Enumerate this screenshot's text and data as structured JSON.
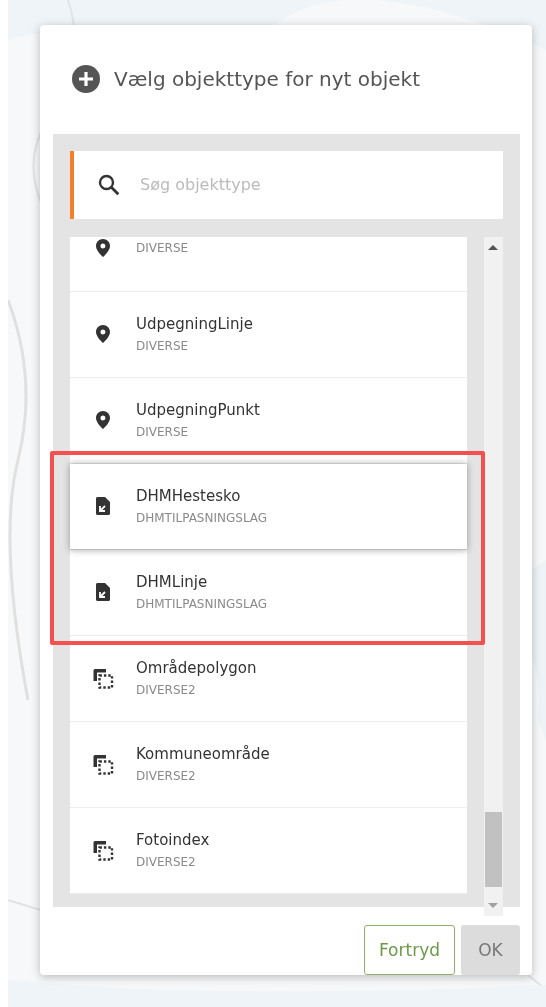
{
  "dialog": {
    "title": "Vælg objekttype for nyt objekt",
    "search": {
      "placeholder": "Søg objekttype"
    },
    "items": [
      {
        "category": "DIVERSE",
        "kind": "pin",
        "hovered": false,
        "highlighted": false
      },
      {
        "name": "UdpegningLinje",
        "category": "DIVERSE",
        "kind": "pin",
        "hovered": false,
        "highlighted": false
      },
      {
        "name": "UdpegningPunkt",
        "category": "DIVERSE",
        "kind": "pin",
        "hovered": false,
        "highlighted": false
      },
      {
        "name": "DHMHestesko",
        "category": "DHMTILPASNINGSLAG",
        "kind": "file",
        "hovered": true,
        "highlighted": true
      },
      {
        "name": "DHMLinje",
        "category": "DHMTILPASNINGSLAG",
        "kind": "file",
        "hovered": false,
        "highlighted": true
      },
      {
        "name": "Områdepolygon",
        "category": "DIVERSE2",
        "kind": "polygon",
        "hovered": false,
        "highlighted": false
      },
      {
        "name": "Kommuneområde",
        "category": "DIVERSE2",
        "kind": "polygon",
        "hovered": false,
        "highlighted": false
      },
      {
        "name": "Fotoindex",
        "category": "DIVERSE2",
        "kind": "polygon",
        "hovered": false,
        "highlighted": false
      }
    ],
    "buttons": [
      {
        "label": "Fortryd",
        "kind": "outline"
      },
      {
        "label": "OK",
        "kind": "filled"
      }
    ]
  }
}
